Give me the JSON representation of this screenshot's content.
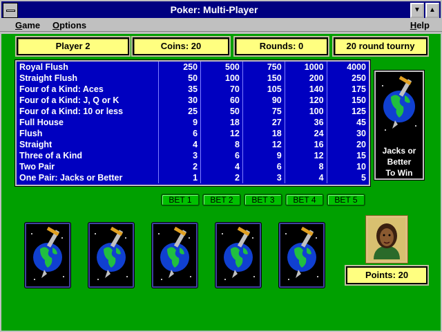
{
  "window": {
    "title": "Poker: Multi-Player",
    "minimize_glyph": "▼",
    "maximize_glyph": "▲"
  },
  "menu": {
    "game": "Game",
    "options": "Options",
    "help": "Help"
  },
  "status": {
    "player": "Player 2",
    "coins": "Coins: 20",
    "rounds": "Rounds: 0",
    "mode": "20 round tourny"
  },
  "paytable": [
    {
      "hand": "Royal Flush",
      "pays": [
        "250",
        "500",
        "750",
        "1000",
        "4000"
      ]
    },
    {
      "hand": "Straight Flush",
      "pays": [
        "50",
        "100",
        "150",
        "200",
        "250"
      ]
    },
    {
      "hand": "Four of a Kind: Aces",
      "pays": [
        "35",
        "70",
        "105",
        "140",
        "175"
      ]
    },
    {
      "hand": "Four of a Kind: J, Q or K",
      "pays": [
        "30",
        "60",
        "90",
        "120",
        "150"
      ]
    },
    {
      "hand": "Four of a Kind: 10 or less",
      "pays": [
        "25",
        "50",
        "75",
        "100",
        "125"
      ]
    },
    {
      "hand": "Full House",
      "pays": [
        "9",
        "18",
        "27",
        "36",
        "45"
      ]
    },
    {
      "hand": "Flush",
      "pays": [
        "6",
        "12",
        "18",
        "24",
        "30"
      ]
    },
    {
      "hand": "Straight",
      "pays": [
        "4",
        "8",
        "12",
        "16",
        "20"
      ]
    },
    {
      "hand": "Three of a Kind",
      "pays": [
        "3",
        "6",
        "9",
        "12",
        "15"
      ]
    },
    {
      "hand": "Two Pair",
      "pays": [
        "2",
        "4",
        "6",
        "8",
        "10"
      ]
    },
    {
      "hand": "One Pair: Jacks or Better",
      "pays": [
        "1",
        "2",
        "3",
        "4",
        "5"
      ]
    }
  ],
  "side_card": {
    "line1": "Jacks or",
    "line2": "Better",
    "line3": "To Win"
  },
  "bets": {
    "bet1": "BET 1",
    "bet2": "BET 2",
    "bet3": "BET 3",
    "bet4": "BET 4",
    "bet5": "BET 5"
  },
  "points": "Points: 20",
  "colors": {
    "felt": "#00a000",
    "paytable": "#0000c0",
    "info": "#ffff80",
    "titlebar": "#000080"
  }
}
